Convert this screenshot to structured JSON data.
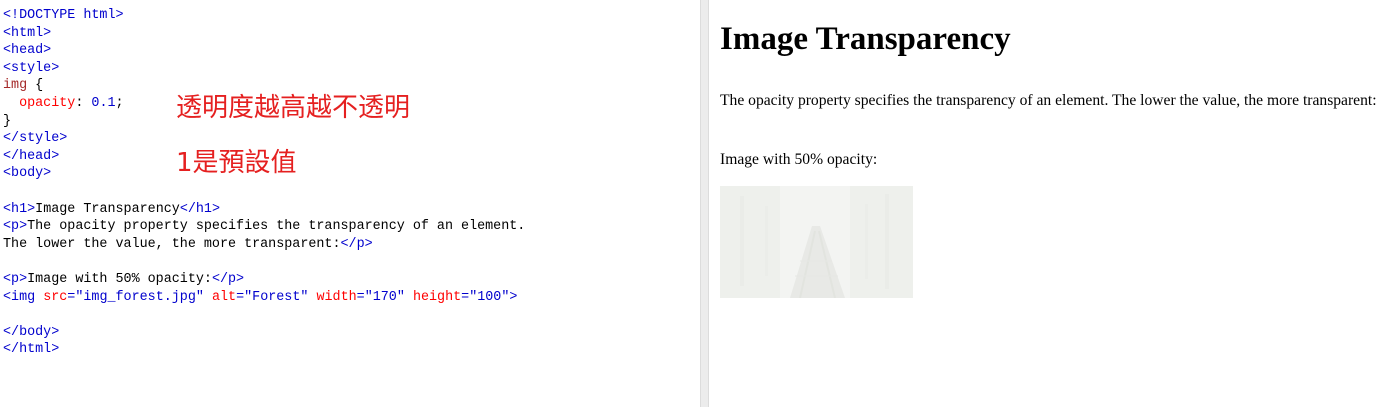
{
  "code_lines": [
    {
      "parts": [
        {
          "c": "t",
          "v": "<!DOCTYPE html>"
        }
      ]
    },
    {
      "parts": [
        {
          "c": "t",
          "v": "<html>"
        }
      ]
    },
    {
      "parts": [
        {
          "c": "t",
          "v": "<head>"
        }
      ]
    },
    {
      "parts": [
        {
          "c": "t",
          "v": "<style>"
        }
      ]
    },
    {
      "parts": [
        {
          "c": "sp",
          "v": "img"
        },
        {
          "c": "",
          "v": " {"
        }
      ]
    },
    {
      "parts": [
        {
          "c": "",
          "v": "  "
        },
        {
          "c": "a",
          "v": "opacity"
        },
        {
          "c": "",
          "v": ": "
        },
        {
          "c": "s",
          "v": "0.1"
        },
        {
          "c": "",
          "v": ";"
        }
      ]
    },
    {
      "parts": [
        {
          "c": "",
          "v": "}"
        }
      ]
    },
    {
      "parts": [
        {
          "c": "t",
          "v": "</style>"
        }
      ]
    },
    {
      "parts": [
        {
          "c": "t",
          "v": "</head>"
        }
      ]
    },
    {
      "parts": [
        {
          "c": "t",
          "v": "<body>"
        }
      ]
    },
    {
      "parts": [
        {
          "c": "",
          "v": ""
        }
      ]
    },
    {
      "parts": [
        {
          "c": "t",
          "v": "<h1>"
        },
        {
          "c": "",
          "v": "Image Transparency"
        },
        {
          "c": "t",
          "v": "</h1>"
        }
      ]
    },
    {
      "parts": [
        {
          "c": "t",
          "v": "<p>"
        },
        {
          "c": "",
          "v": "The opacity property specifies the transparency of an element."
        }
      ]
    },
    {
      "parts": [
        {
          "c": "",
          "v": "The lower the value, the more transparent:"
        },
        {
          "c": "t",
          "v": "</p>"
        }
      ]
    },
    {
      "parts": [
        {
          "c": "",
          "v": ""
        }
      ]
    },
    {
      "parts": [
        {
          "c": "t",
          "v": "<p>"
        },
        {
          "c": "",
          "v": "Image with 50% opacity:"
        },
        {
          "c": "t",
          "v": "</p>"
        }
      ]
    },
    {
      "parts": [
        {
          "c": "t",
          "v": "<img "
        },
        {
          "c": "a",
          "v": "src"
        },
        {
          "c": "t",
          "v": "="
        },
        {
          "c": "s",
          "v": "\"img_forest.jpg\""
        },
        {
          "c": "",
          "v": " "
        },
        {
          "c": "a",
          "v": "alt"
        },
        {
          "c": "t",
          "v": "="
        },
        {
          "c": "s",
          "v": "\"Forest\""
        },
        {
          "c": "",
          "v": " "
        },
        {
          "c": "a",
          "v": "width"
        },
        {
          "c": "t",
          "v": "="
        },
        {
          "c": "s",
          "v": "\"170\""
        },
        {
          "c": "",
          "v": " "
        },
        {
          "c": "a",
          "v": "height"
        },
        {
          "c": "t",
          "v": "="
        },
        {
          "c": "s",
          "v": "\"100\""
        },
        {
          "c": "t",
          "v": ">"
        }
      ]
    },
    {
      "parts": [
        {
          "c": "",
          "v": ""
        }
      ]
    },
    {
      "parts": [
        {
          "c": "t",
          "v": "</body>"
        }
      ]
    },
    {
      "parts": [
        {
          "c": "t",
          "v": "</html>"
        }
      ]
    }
  ],
  "annotations": {
    "note1": "透明度越高越不透明",
    "note2": "1是預設值"
  },
  "preview": {
    "heading": "Image Transparency",
    "paragraph1": "The opacity property specifies the transparency of an element. The lower the value, the more transparent:",
    "paragraph2": "Image with 50% opacity:",
    "image_alt": "Forest",
    "image_opacity": 0.1
  },
  "colors": {
    "tag": "#0000cd",
    "attribute": "#ff0000",
    "value": "#0000cd",
    "selector": "#a52a2a",
    "annotation": "#e52020"
  }
}
